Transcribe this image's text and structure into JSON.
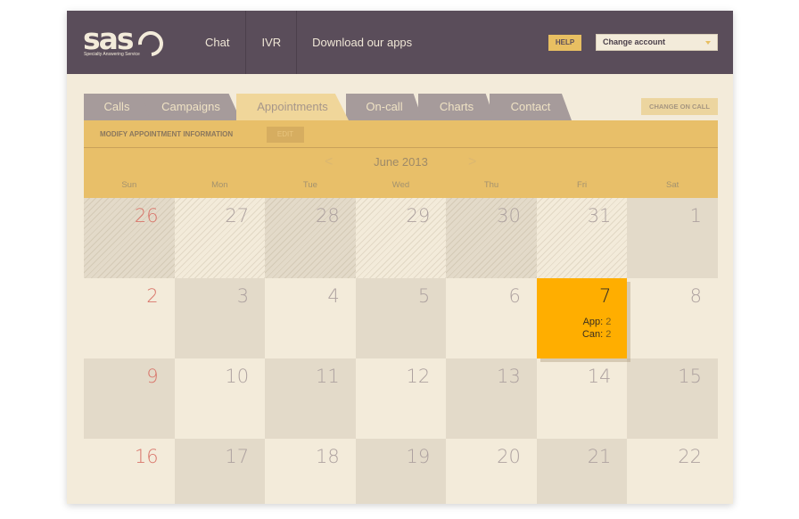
{
  "header": {
    "logo": {
      "text": "sas",
      "tagline": "Specialty Answering Service"
    },
    "nav": [
      {
        "label": "Chat"
      },
      {
        "label": "IVR"
      },
      {
        "label": "Download our apps"
      }
    ],
    "help_label": "HELP",
    "account_select": {
      "selected": "Change account"
    }
  },
  "tabs": [
    {
      "label": "Calls",
      "active": false
    },
    {
      "label": "Campaigns",
      "active": false
    },
    {
      "label": "Appointments",
      "active": true
    },
    {
      "label": "On-call",
      "active": false
    },
    {
      "label": "Charts",
      "active": false
    },
    {
      "label": "Contact",
      "active": false
    }
  ],
  "change_on_call_label": "CHANGE ON CALL",
  "panel": {
    "modify_label": "MODIFY APPOINTMENT INFORMATION",
    "edit_label": "EDIT"
  },
  "calendar": {
    "month_title": "June 2013",
    "prev": "<",
    "next": ">",
    "weekdays": [
      "Sun",
      "Mon",
      "Tue",
      "Wed",
      "Thu",
      "Fri",
      "Sat"
    ],
    "weeks": [
      [
        {
          "day": "26",
          "other": true
        },
        {
          "day": "27",
          "other": true
        },
        {
          "day": "28",
          "other": true
        },
        {
          "day": "29",
          "other": true
        },
        {
          "day": "30",
          "other": true
        },
        {
          "day": "31",
          "other": true
        },
        {
          "day": "1",
          "other": false
        }
      ],
      [
        {
          "day": "2"
        },
        {
          "day": "3"
        },
        {
          "day": "4"
        },
        {
          "day": "5"
        },
        {
          "day": "6"
        },
        {
          "day": "7",
          "today": true,
          "app": "2",
          "can": "2"
        },
        {
          "day": "8"
        }
      ],
      [
        {
          "day": "9"
        },
        {
          "day": "10"
        },
        {
          "day": "11"
        },
        {
          "day": "12"
        },
        {
          "day": "13"
        },
        {
          "day": "14"
        },
        {
          "day": "15"
        }
      ],
      [
        {
          "day": "16"
        },
        {
          "day": "17"
        },
        {
          "day": "18"
        },
        {
          "day": "19"
        },
        {
          "day": "20"
        },
        {
          "day": "21"
        },
        {
          "day": "22"
        }
      ]
    ],
    "today_labels": {
      "app": "App:",
      "can": "Can:"
    }
  },
  "colors": {
    "header_bg": "#5a4d5a",
    "accent": "#e8bf69",
    "today": "#ffae00",
    "sunday": "#d9766b"
  }
}
